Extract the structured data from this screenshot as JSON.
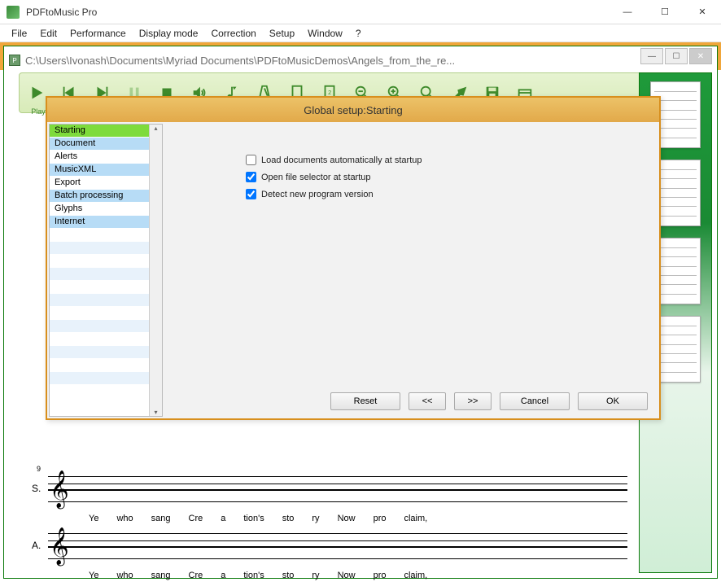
{
  "app": {
    "title": "PDFtoMusic Pro"
  },
  "menu": [
    "File",
    "Edit",
    "Performance",
    "Display mode",
    "Correction",
    "Setup",
    "Window",
    "?"
  ],
  "document": {
    "path": "C:\\Users\\Ivonash\\Documents\\Myriad Documents\\PDFtoMusicDemos\\Angels_from_the_re..."
  },
  "toolbar": {
    "play": "Play"
  },
  "dialog": {
    "title": "Global setup:Starting",
    "categories": [
      "Starting",
      "Document",
      "Alerts",
      "MusicXML",
      "Export",
      "Batch processing",
      "Glyphs",
      "Internet"
    ],
    "selected": "Starting",
    "options": {
      "load_auto": {
        "label": "Load documents automatically at startup",
        "checked": false
      },
      "open_selector": {
        "label": "Open file selector at startup",
        "checked": true
      },
      "detect_version": {
        "label": "Detect new program version",
        "checked": true
      }
    },
    "buttons": {
      "reset": "Reset",
      "prev": "<<",
      "next": ">>",
      "cancel": "Cancel",
      "ok": "OK"
    }
  },
  "score": {
    "measure_no": "9",
    "voices": [
      {
        "label": "S.",
        "lyrics": [
          "Ye",
          "who",
          "sang",
          "Cre",
          "-",
          "a",
          "-",
          "tion's",
          "sto",
          "-",
          "ry",
          "Now",
          "pro",
          "-",
          "claim,"
        ]
      },
      {
        "label": "A.",
        "lyrics": [
          "Ye",
          "who",
          "sang",
          "Cre",
          "-",
          "a",
          "-",
          "tion's",
          "sto",
          "-",
          "ry",
          "Now",
          "pro",
          "-",
          "claim,"
        ]
      }
    ]
  }
}
